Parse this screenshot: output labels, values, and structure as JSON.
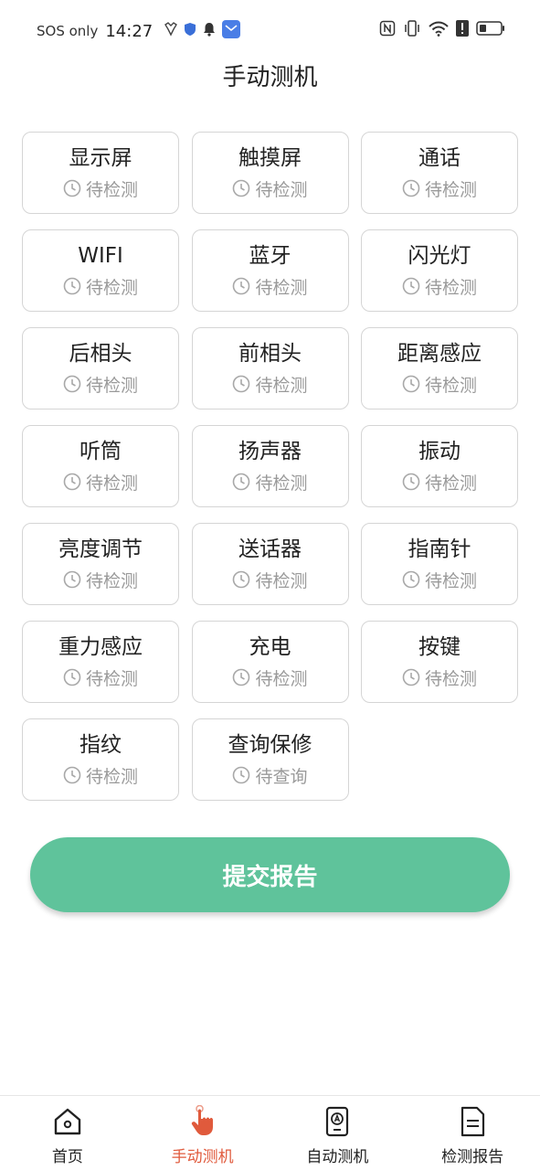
{
  "status_bar": {
    "carrier": "SOS only",
    "time": "14:27"
  },
  "header": {
    "title": "手动测机"
  },
  "tests": [
    {
      "name": "显示屏",
      "status": "待检测"
    },
    {
      "name": "触摸屏",
      "status": "待检测"
    },
    {
      "name": "通话",
      "status": "待检测"
    },
    {
      "name": "WIFI",
      "status": "待检测"
    },
    {
      "name": "蓝牙",
      "status": "待检测"
    },
    {
      "name": "闪光灯",
      "status": "待检测"
    },
    {
      "name": "后相头",
      "status": "待检测"
    },
    {
      "name": "前相头",
      "status": "待检测"
    },
    {
      "name": "距离感应",
      "status": "待检测"
    },
    {
      "name": "听筒",
      "status": "待检测"
    },
    {
      "name": "扬声器",
      "status": "待检测"
    },
    {
      "name": "振动",
      "status": "待检测"
    },
    {
      "name": "亮度调节",
      "status": "待检测"
    },
    {
      "name": "送话器",
      "status": "待检测"
    },
    {
      "name": "指南针",
      "status": "待检测"
    },
    {
      "name": "重力感应",
      "status": "待检测"
    },
    {
      "name": "充电",
      "status": "待检测"
    },
    {
      "name": "按键",
      "status": "待检测"
    },
    {
      "name": "指纹",
      "status": "待检测"
    },
    {
      "name": "查询保修",
      "status": "待查询"
    }
  ],
  "actions": {
    "submit_label": "提交报告"
  },
  "nav": {
    "items": [
      {
        "label": "首页",
        "icon": "home-icon"
      },
      {
        "label": "手动测机",
        "icon": "hand-pointer-icon",
        "active": true
      },
      {
        "label": "自动测机",
        "icon": "auto-test-icon"
      },
      {
        "label": "检测报告",
        "icon": "report-icon"
      }
    ]
  },
  "colors": {
    "accent_green": "#5fc39b",
    "active_nav": "#e05a3c",
    "status_gray": "#9a9a9a"
  }
}
